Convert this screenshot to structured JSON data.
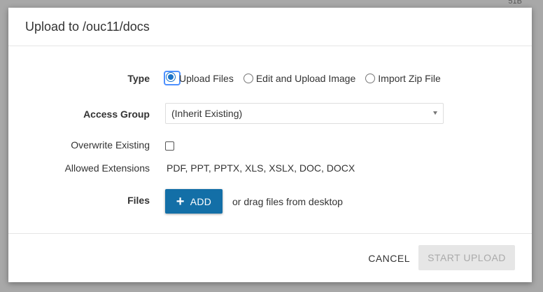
{
  "background": {
    "corner_text": "51B"
  },
  "dialog": {
    "title": "Upload to /ouc11/docs",
    "type": {
      "label": "Type",
      "options": [
        "Upload Files",
        "Edit and Upload Image",
        "Import Zip File"
      ],
      "selected": "Upload Files"
    },
    "access_group": {
      "label": "Access Group",
      "value": "(Inherit Existing)"
    },
    "overwrite": {
      "label": "Overwrite Existing",
      "checked": false
    },
    "extensions": {
      "label": "Allowed Extensions",
      "value": "PDF,  PPT,  PPTX,  XLS,  XSLX,  DOC,  DOCX"
    },
    "files": {
      "label": "Files",
      "add_label": "ADD",
      "drag_text": "or drag files from desktop"
    },
    "footer": {
      "cancel_label": "CANCEL",
      "start_label": "START UPLOAD"
    }
  },
  "colors": {
    "primary": "#136fa7",
    "radio_selected": "#1a73c8",
    "disabled_bg": "#e6e6e6",
    "disabled_text": "#aaaaaa",
    "overlay": "#a8a8a8"
  }
}
